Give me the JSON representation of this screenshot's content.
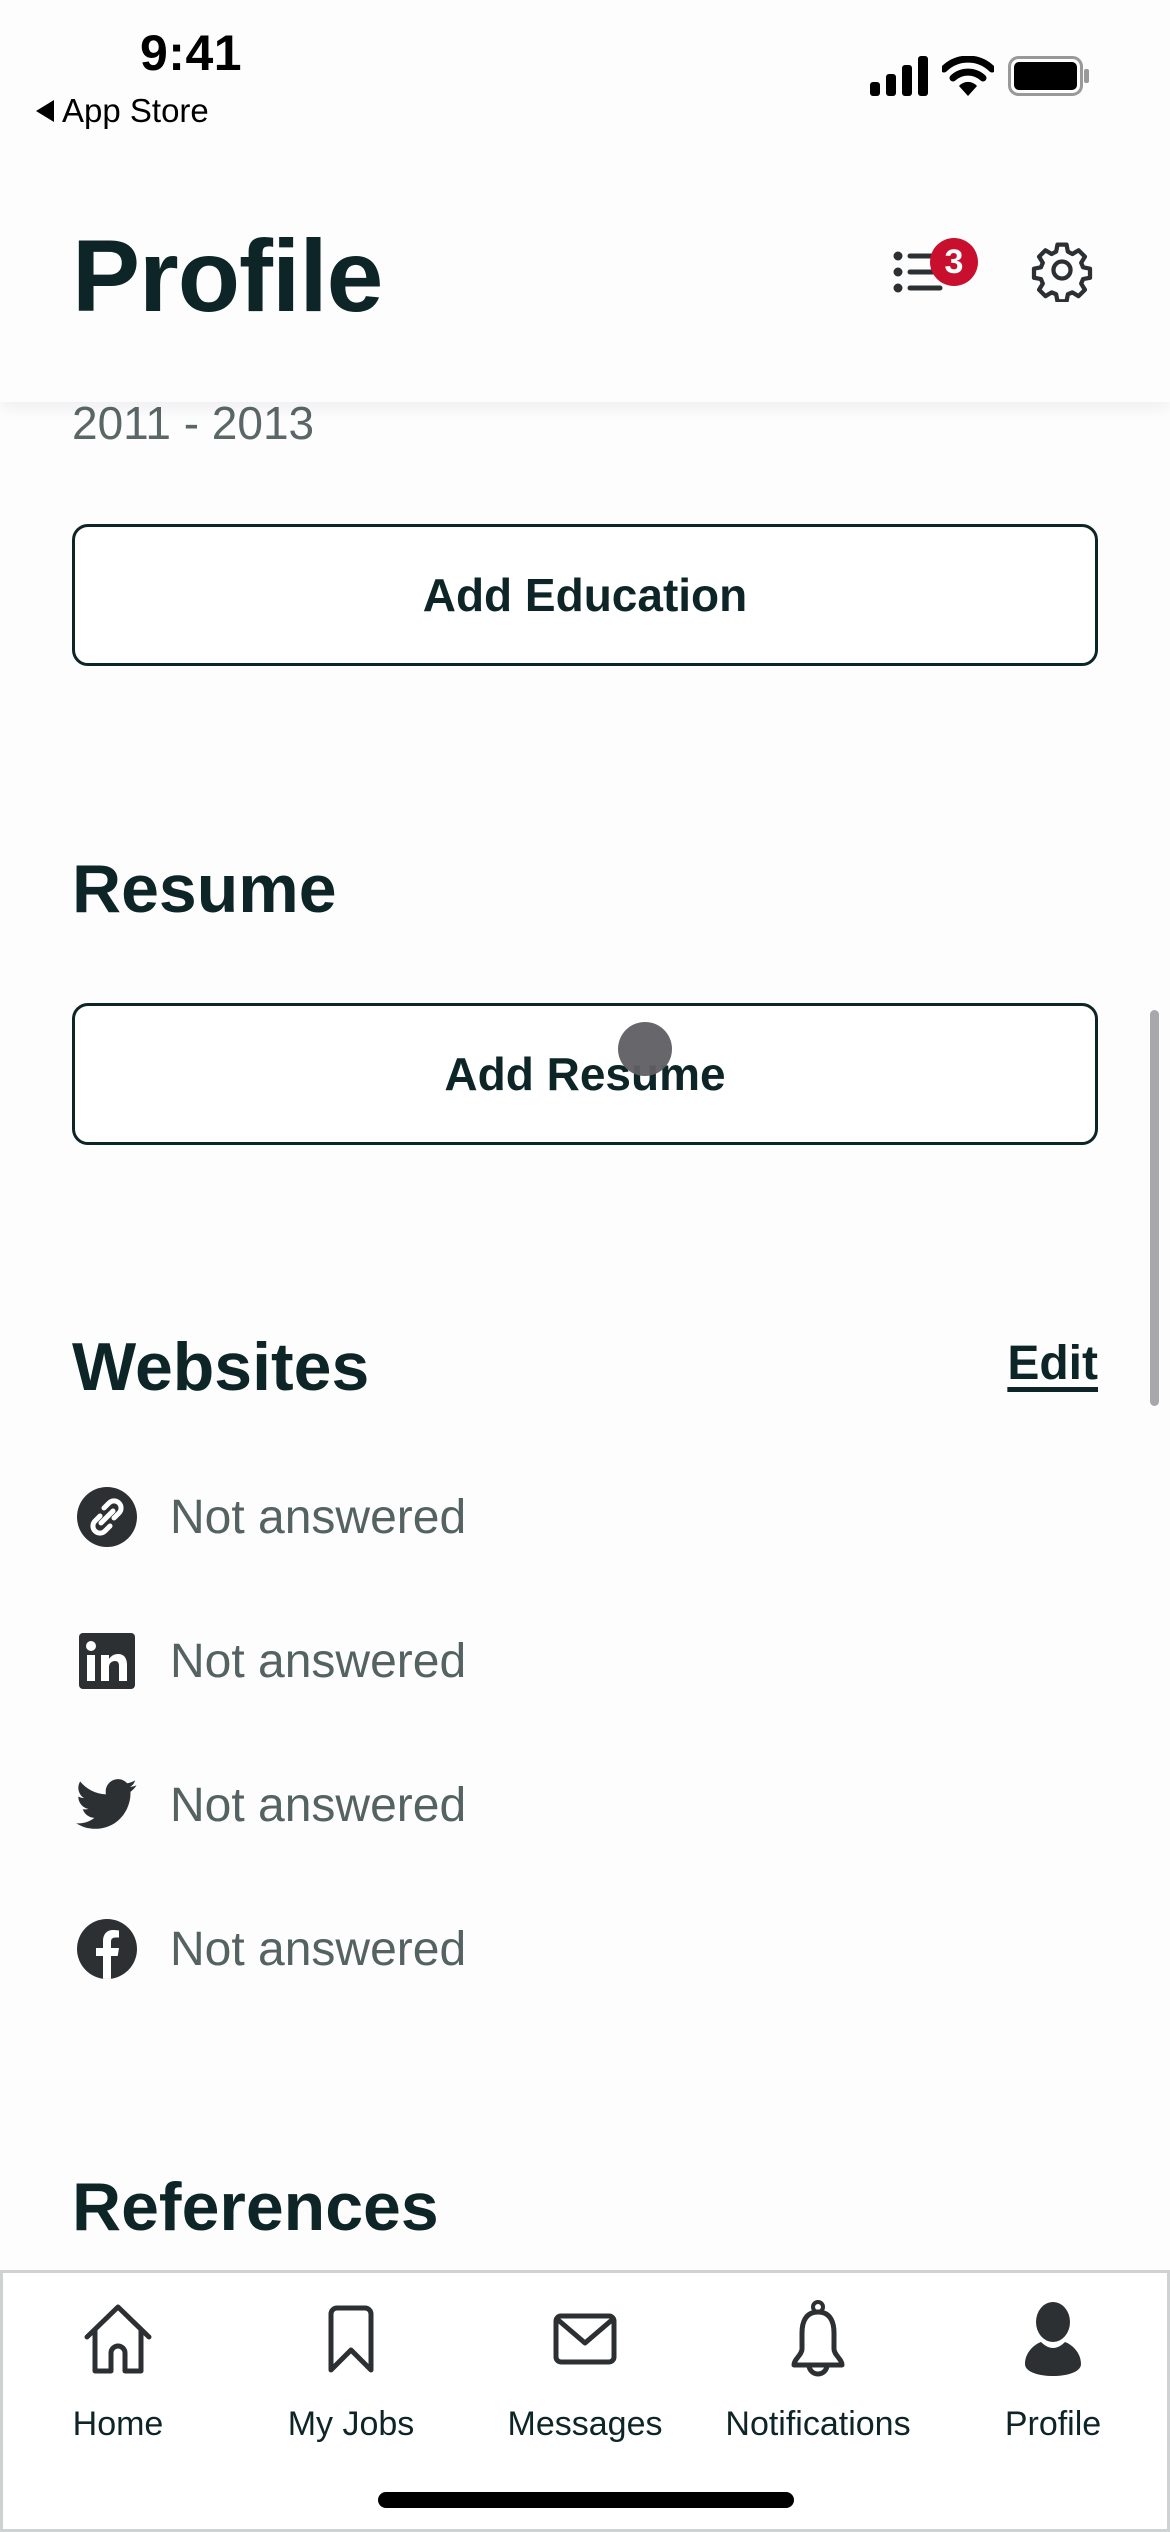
{
  "status_bar": {
    "time": "9:41",
    "back_label": "App Store",
    "icons": [
      "cellular-signal-icon",
      "wifi-icon",
      "battery-icon"
    ]
  },
  "header": {
    "title": "Profile",
    "checklist_badge_count": "3",
    "checklist_icon": "checklist-icon",
    "settings_icon": "gear-icon",
    "badge_color": "#c8102e"
  },
  "education": {
    "date_range": "2011 - 2013",
    "add_button": "Add Education"
  },
  "resume": {
    "title": "Resume",
    "add_button": "Add Resume"
  },
  "websites": {
    "title": "Websites",
    "edit_label": "Edit",
    "items": [
      {
        "icon": "link-icon",
        "value": "Not answered"
      },
      {
        "icon": "linkedin-icon",
        "value": "Not answered"
      },
      {
        "icon": "twitter-icon",
        "value": "Not answered"
      },
      {
        "icon": "facebook-icon",
        "value": "Not answered"
      }
    ]
  },
  "references": {
    "title": "References"
  },
  "tab_bar": {
    "active": "Profile",
    "tabs": [
      {
        "label": "Home",
        "icon": "home-icon"
      },
      {
        "label": "My Jobs",
        "icon": "bookmark-icon"
      },
      {
        "label": "Messages",
        "icon": "envelope-icon"
      },
      {
        "label": "Notifications",
        "icon": "bell-icon"
      },
      {
        "label": "Profile",
        "icon": "person-icon"
      }
    ]
  },
  "colors": {
    "primary_text": "#0d2526",
    "secondary_text": "#546362",
    "icon": "#2d3033"
  }
}
